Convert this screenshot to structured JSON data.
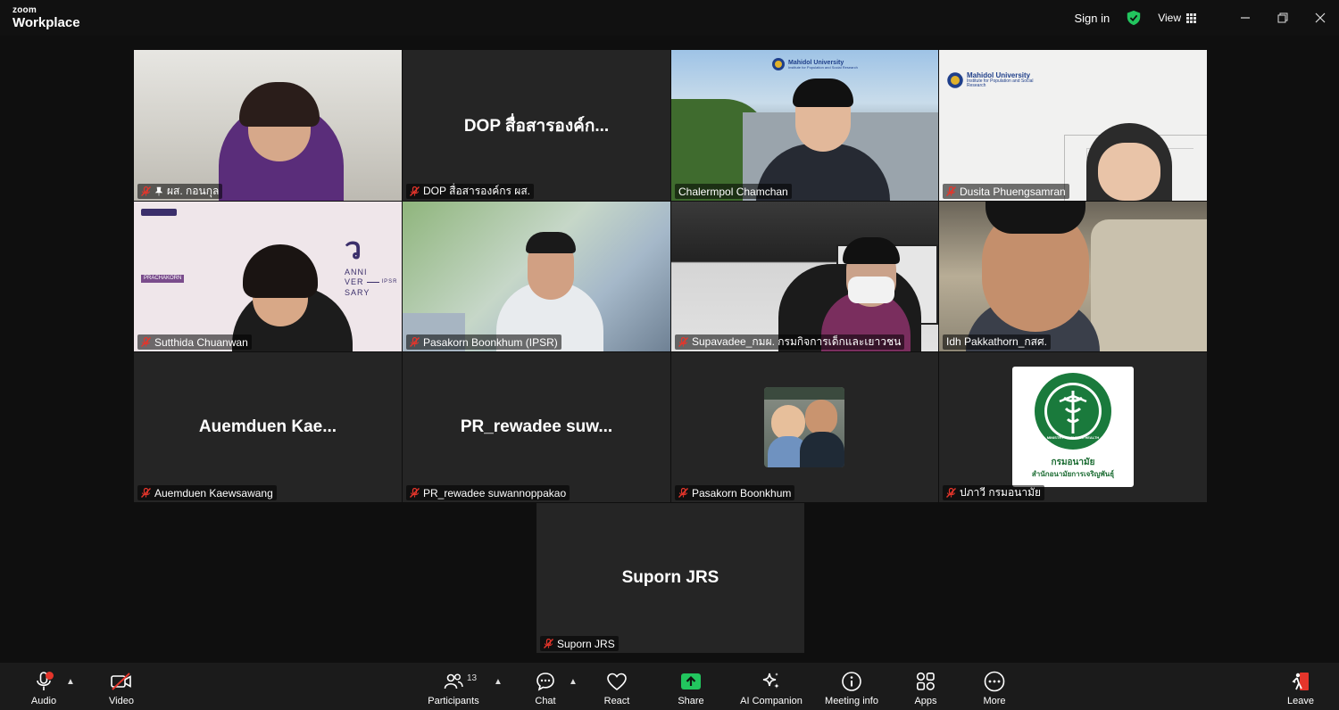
{
  "app": {
    "brand_small": "zoom",
    "brand_large": "Workplace"
  },
  "titlebar": {
    "sign_in": "Sign in",
    "view": "View",
    "shield_icon": "shield-check-icon",
    "shield_color": "#22c55e"
  },
  "participants": [
    {
      "name": "ผส. กอนกุล",
      "muted": true,
      "pinned": true
    },
    {
      "name": "DOP สื่อสารองค์กร ผส.",
      "display": "DOP สื่อสารองค์ก...",
      "muted": true
    },
    {
      "name": "Chalermpol Chamchan",
      "muted": false,
      "logo_title": "Mahidol University",
      "logo_sub": "Institute for Population and Social Research"
    },
    {
      "name": "Dusita Phuengsamran",
      "muted": true,
      "logo_title": "Mahidol University",
      "logo_sub": "Institute for Population and Social Research"
    },
    {
      "name": "Sutthida Chuanwan",
      "muted": true,
      "bg_tag": "PRACHAKORN",
      "bg_text": [
        "ANNI",
        "VER",
        "SARY"
      ],
      "bg_ipsr": "IPSR"
    },
    {
      "name": "Pasakorn Boonkhum (IPSR)",
      "muted": true
    },
    {
      "name": "Supavadee_กมผ. กรมกิจการเด็กและเยาวชน",
      "muted": true
    },
    {
      "name": "Idh Pakkathorn_กสศ.",
      "muted": false,
      "active_speaker": true
    },
    {
      "name": "Auemduen Kaewsawang",
      "display": "Auemduen  Kae...",
      "muted": true
    },
    {
      "name": "PR_rewadee suwannoppakao",
      "display": "PR_rewadee  suw...",
      "muted": true
    },
    {
      "name": "Pasakorn Boonkhum",
      "muted": true
    },
    {
      "name": "ปภาวี กรมอนามัย",
      "muted": true,
      "logo_line1": "กรมอนามัย",
      "logo_line2": "สำนักอนามัยการเจริญพันธุ์",
      "seal_text": "MINISTRY OF PUBLIC HEALTH"
    },
    {
      "name": "Suporn JRS",
      "display": "Suporn JRS",
      "muted": true
    }
  ],
  "toolbar": {
    "audio": "Audio",
    "video": "Video",
    "participants": "Participants",
    "participants_count": "13",
    "chat": "Chat",
    "react": "React",
    "share": "Share",
    "ai_companion": "AI Companion",
    "meeting_info": "Meeting info",
    "apps": "Apps",
    "more": "More",
    "leave": "Leave",
    "share_color": "#22c55e",
    "leave_color": "#e5352b"
  }
}
